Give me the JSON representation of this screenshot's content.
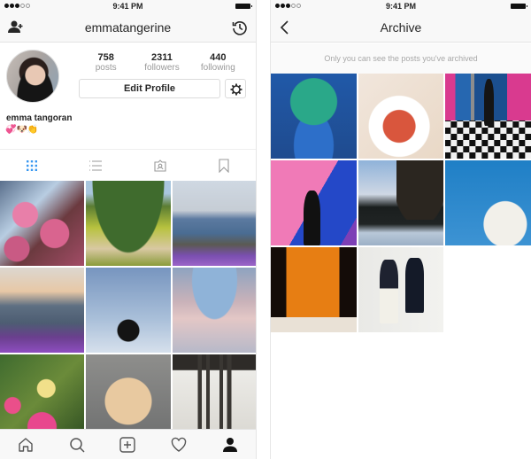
{
  "status_bar": {
    "time": "9:41 PM",
    "signal_bars_filled": 3,
    "signal_bars_total": 5
  },
  "profile_screen": {
    "username": "emmatangerine",
    "add_user_icon": "person-plus-icon",
    "archive_icon": "history-icon",
    "stats": [
      {
        "value": "758",
        "label": "posts"
      },
      {
        "value": "2311",
        "label": "followers"
      },
      {
        "value": "440",
        "label": "following"
      }
    ],
    "edit_profile_label": "Edit Profile",
    "settings_icon": "gear-icon",
    "full_name": "emma tangoran",
    "bio": "💞🐶👏",
    "view_tabs": [
      {
        "name": "grid",
        "icon": "grid-icon",
        "active": true
      },
      {
        "name": "list",
        "icon": "list-icon",
        "active": false
      },
      {
        "name": "tagged",
        "icon": "tagged-person-icon",
        "active": false
      },
      {
        "name": "saved",
        "icon": "bookmark-icon",
        "active": false
      }
    ],
    "posts": [
      {
        "subject": "pink blossoms"
      },
      {
        "subject": "hillside trail"
      },
      {
        "subject": "bay shoreline"
      },
      {
        "subject": "ocean sunset with bird"
      },
      {
        "subject": "palm tree silhouette"
      },
      {
        "subject": "clouds from above"
      },
      {
        "subject": "flower bouquet"
      },
      {
        "subject": "terrier dog"
      },
      {
        "subject": "pier underside"
      }
    ],
    "tab_bar": [
      {
        "name": "home",
        "icon": "home-icon",
        "active": false
      },
      {
        "name": "search",
        "icon": "search-icon",
        "active": false
      },
      {
        "name": "new-post",
        "icon": "plus-square-icon",
        "active": false
      },
      {
        "name": "activity",
        "icon": "heart-icon",
        "active": false
      },
      {
        "name": "profile",
        "icon": "profile-icon",
        "active": true
      }
    ]
  },
  "archive_screen": {
    "title": "Archive",
    "back_icon": "chevron-left-icon",
    "note": "Only you can see the posts you've archived",
    "posts": [
      {
        "subject": "monstera leaf portrait"
      },
      {
        "subject": "brunch plate"
      },
      {
        "subject": "mirror selfie on checkered floor"
      },
      {
        "subject": "woman at colorful wall"
      },
      {
        "subject": "lake at dusk"
      },
      {
        "subject": "blossoming tree against blue sky"
      },
      {
        "subject": "orange curtain and pink shoes"
      },
      {
        "subject": "two women mirror selfie"
      }
    ]
  },
  "colors": {
    "accent_blue": "#3897f0",
    "text": "#262626",
    "muted": "#999999",
    "border": "#dbdbdb"
  }
}
